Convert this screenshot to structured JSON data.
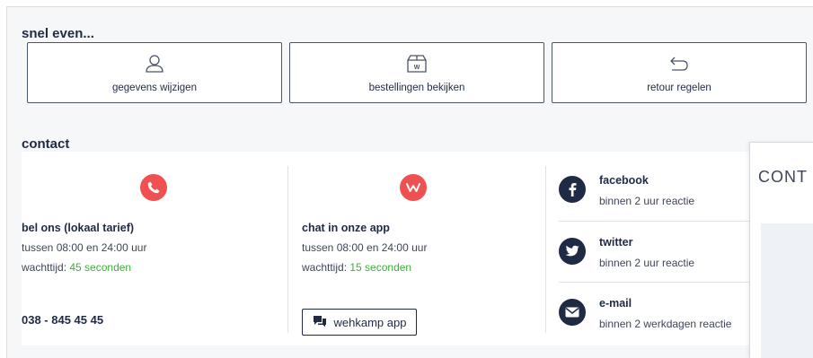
{
  "quick": {
    "title": "snel even...",
    "cards": [
      {
        "label": "gegevens wijzigen",
        "icon": "user-icon"
      },
      {
        "label": "bestellingen bekijken",
        "icon": "package-icon"
      },
      {
        "label": "retour regelen",
        "icon": "return-arrow-icon"
      }
    ]
  },
  "contact": {
    "title": "contact",
    "phone": {
      "title": "bel ons (lokaal tarief)",
      "hours": "tussen 08:00 en 24:00 uur",
      "wait_label": "wachttijd: ",
      "wait_value": "45 seconden",
      "number": "038 - 845 45 45",
      "icon": "phone-icon"
    },
    "chat": {
      "title": "chat in onze app",
      "hours": "tussen 08:00 en 24:00 uur",
      "wait_label": "wachttijd: ",
      "wait_value": "15 seconden",
      "button_label": "wehkamp app",
      "icon": "wehkamp-logo-icon"
    },
    "social": [
      {
        "title": "facebook",
        "sub": "binnen 2 uur reactie",
        "icon": "facebook-icon"
      },
      {
        "title": "twitter",
        "sub": "binnen 2 uur reactie",
        "icon": "twitter-icon"
      },
      {
        "title": "e-mail",
        "sub": "binnen 2 werkdagen reactie",
        "icon": "mail-icon"
      }
    ]
  },
  "overlay": {
    "title": "CONT"
  },
  "colors": {
    "accent": "#f0504f",
    "navy": "#1f2a44",
    "green": "#3dae3a"
  }
}
